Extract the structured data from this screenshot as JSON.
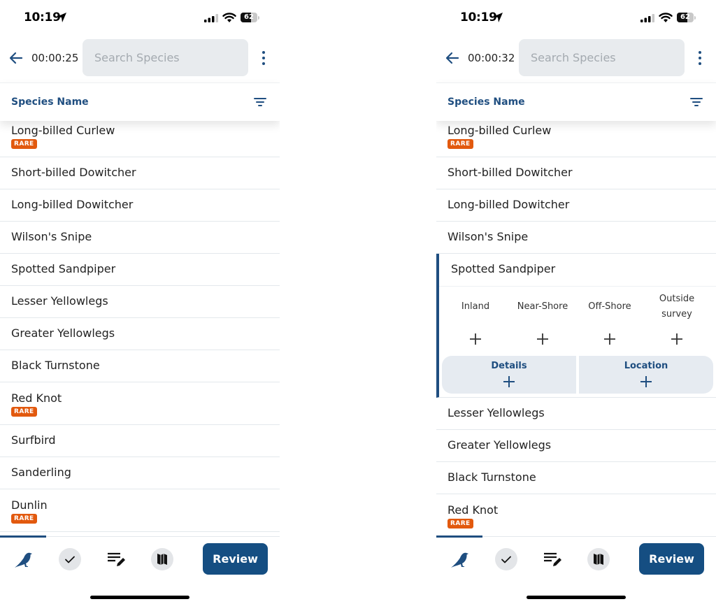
{
  "colors": {
    "primary": "#1f4e80",
    "review_button": "#154e82",
    "rare_badge": "#e2590e",
    "search_bg": "#e8ebee",
    "detail_button_bg": "#e6ebf1"
  },
  "screens": [
    {
      "status_bar": {
        "time": "10:19",
        "battery": "62",
        "battery_level": 0.62
      },
      "app_bar": {
        "timer": "00:00:25",
        "search_placeholder": "Search Species",
        "search_value": ""
      },
      "list_header": {
        "title": "Species Name"
      },
      "species": [
        {
          "name": "Long-billed Curlew",
          "rare": true,
          "badge": "RARE"
        },
        {
          "name": "Short-billed Dowitcher",
          "rare": false
        },
        {
          "name": "Long-billed Dowitcher",
          "rare": false
        },
        {
          "name": "Wilson's Snipe",
          "rare": false
        },
        {
          "name": "Spotted Sandpiper",
          "rare": false
        },
        {
          "name": "Lesser Yellowlegs",
          "rare": false
        },
        {
          "name": "Greater Yellowlegs",
          "rare": false
        },
        {
          "name": "Black Turnstone",
          "rare": false
        },
        {
          "name": "Red Knot",
          "rare": true,
          "badge": "RARE"
        },
        {
          "name": "Surfbird",
          "rare": false
        },
        {
          "name": "Sanderling",
          "rare": false
        },
        {
          "name": "Dunlin",
          "rare": true,
          "badge": "RARE"
        }
      ],
      "bottom_bar": {
        "review_label": "Review",
        "active_tab": "species"
      }
    },
    {
      "status_bar": {
        "time": "10:19",
        "battery": "62",
        "battery_level": 0.62
      },
      "app_bar": {
        "timer": "00:00:32",
        "search_placeholder": "Search Species",
        "search_value": ""
      },
      "list_header": {
        "title": "Species Name"
      },
      "species_before": [
        {
          "name": "Long-billed Curlew",
          "rare": true,
          "badge": "RARE"
        },
        {
          "name": "Short-billed Dowitcher",
          "rare": false
        },
        {
          "name": "Long-billed Dowitcher",
          "rare": false
        },
        {
          "name": "Wilson's Snipe",
          "rare": false
        }
      ],
      "expanded": {
        "name": "Spotted Sandpiper",
        "categories": [
          {
            "label": "Inland"
          },
          {
            "label": "Near-Shore"
          },
          {
            "label": "Off-Shore"
          },
          {
            "label": "Outside survey"
          }
        ],
        "details_label": "Details",
        "location_label": "Location"
      },
      "species_after": [
        {
          "name": "Lesser Yellowlegs",
          "rare": false
        },
        {
          "name": "Greater Yellowlegs",
          "rare": false
        },
        {
          "name": "Black Turnstone",
          "rare": false
        },
        {
          "name": "Red Knot",
          "rare": true,
          "badge": "RARE"
        }
      ],
      "bottom_bar": {
        "review_label": "Review",
        "active_tab": "species"
      }
    }
  ]
}
